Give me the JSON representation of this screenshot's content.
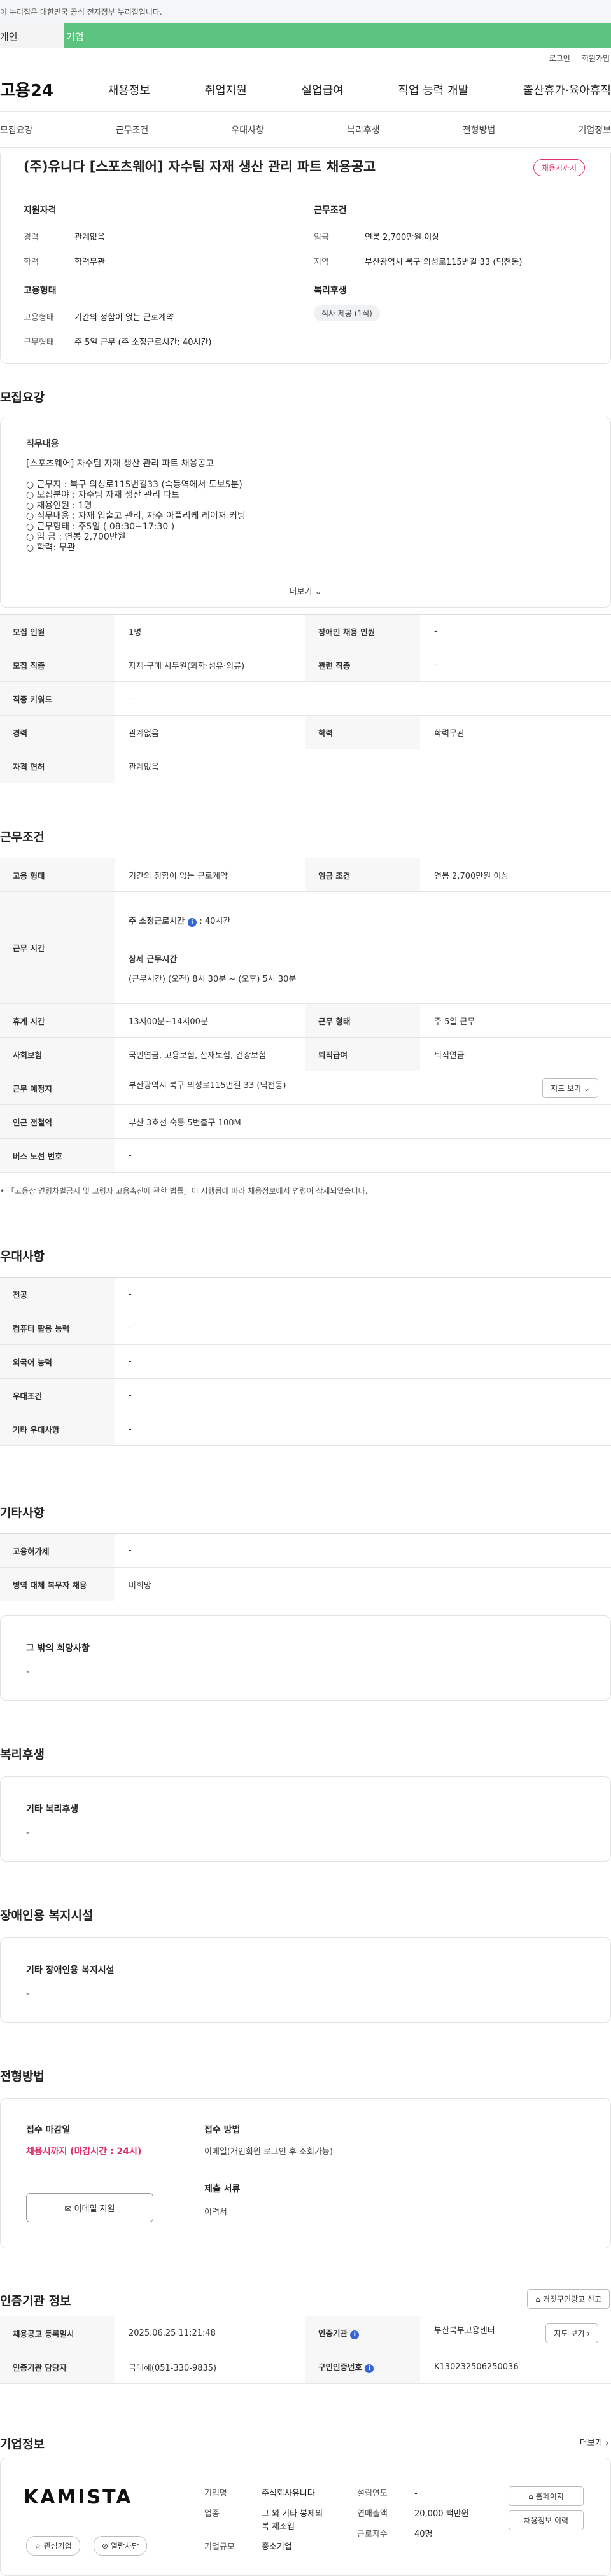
{
  "topbar": {
    "text": "이 누리집은 대한민국 공식 전자정부 누리집입니다."
  },
  "tabs": {
    "a": "개인",
    "b": "기업"
  },
  "util": {
    "login": "로그인",
    "join": "회원가입"
  },
  "gnb": {
    "logo": "고용24",
    "items": [
      "채용정보",
      "취업지원",
      "실업급여",
      "직업 능력 개발",
      "출산휴가·육아휴직"
    ]
  },
  "subnav": [
    "모집요강",
    "근무조건",
    "우대사항",
    "복리후생",
    "전형방법",
    "기업정보"
  ],
  "summary": {
    "title": "(주)유니다 [스포츠웨어] 자수팀 자재 생산 관리 파트 채용공고",
    "badge": "채용시까지",
    "qual": {
      "title": "지원자격",
      "k1": "경력",
      "v1": "관계없음",
      "k2": "학력",
      "v2": "학력무관"
    },
    "cond": {
      "title": "근무조건",
      "k1": "임금",
      "v1": "연봉 2,700만원 이상",
      "k2": "지역",
      "v2": "부산광역시 북구 의성로115번길 33 (덕천동)"
    },
    "emp": {
      "title": "고용형태",
      "k1": "고용형태",
      "v1": "기간의 정함이 없는 근로계약",
      "k2": "근무형태",
      "v2": "주 5일 근무 (주 소정근로시간: 40시간)"
    },
    "welfare": {
      "title": "복리후생",
      "chip": "식사 제공 (1식)"
    }
  },
  "recruit": {
    "title": "모집요강",
    "duty_title": "직무내용",
    "duty_lines": [
      "[스포츠웨어] 자수팀 자재 생산 관리 파트 채용공고",
      "",
      "○ 근무지 : 북구 의성로115번길33 (숙등역에서 도보5분)",
      "○ 모집분야 : 자수팀 자재 생산 관리 파트",
      "○ 채용인원 : 1명",
      "○ 직무내용 : 자재 입출고 관리, 자수 아플리케 레이저 커팅",
      "○ 근무형태 : 주5일 ( 08:30~17:30 )",
      "○ 임 금 : 연봉 2,700만원",
      "○ 학력: 무관"
    ],
    "more": "더보기",
    "table": {
      "r1": [
        "모집 인원",
        "1명",
        "장애인 채용 인원",
        "-"
      ],
      "r2": [
        "모집 직종",
        "자재·구매 사무원(화학·섬유·의류)",
        "관련 직종",
        "-"
      ],
      "r3": [
        "직종 키워드",
        "-"
      ],
      "r4": [
        "경력",
        "관계없음",
        "학력",
        "학력무관"
      ],
      "r5": [
        "자격 면허",
        "관계없음"
      ]
    }
  },
  "work": {
    "title": "근무조건",
    "r1": [
      "고용 형태",
      "기간의 정함이 없는 근로계약",
      "임금 조건",
      "연봉 2,700만원 이상"
    ],
    "r2": {
      "th": "근무 시간",
      "line1": "주 소정근로시간",
      "line1b": ": 40시간",
      "line2": "상세 근무시간",
      "line3": "(근무시간) (오전) 8시 30분 ~ (오후) 5시 30분"
    },
    "r3": [
      "휴게 시간",
      "13시00분~14시00분",
      "근무 형태",
      "주 5일 근무"
    ],
    "r4": [
      "사회보험",
      "국민연금, 고용보험, 산재보험, 건강보험",
      "퇴직급여",
      "퇴직연금"
    ],
    "r5": [
      "근무 예정지",
      "부산광역시 북구 의성로115번길 33 (덕천동)"
    ],
    "map_btn": "지도 보기",
    "r6": [
      "인근 전철역",
      "부산 3호선 숙등 5번출구 100M"
    ],
    "r7": [
      "버스 노선 번호",
      "-"
    ],
    "note": "「고용상 연령차별금지 및 고령자 고용촉진에 관한 법률」이 시행됨에 따라 채용정보에서 연령이 삭제되었습니다."
  },
  "pref": {
    "title": "우대사항",
    "rows": [
      [
        "전공",
        "-"
      ],
      [
        "컴퓨터 활용 능력",
        "-"
      ],
      [
        "외국어 능력",
        "-"
      ],
      [
        "우대조건",
        "-"
      ],
      [
        "기타 우대사항",
        "-"
      ]
    ]
  },
  "etc": {
    "title": "기타사항",
    "rows": [
      [
        "고용허가제",
        "-"
      ],
      [
        "병역 대체 복무자 채용",
        "비희망"
      ]
    ],
    "box_title": "그 밖의 희망사항",
    "box_val": "-"
  },
  "welfare2": {
    "title": "복리후생",
    "box_title": "기타 복리후생",
    "box_val": "-"
  },
  "disabled": {
    "title": "장애인용 복지시설",
    "box_title": "기타 장애인용 복지시설",
    "box_val": "-"
  },
  "process": {
    "title": "전형방법",
    "deadline_title": "접수 마감일",
    "deadline_val": "채용시까지 (마감시간 : 24시)",
    "apply_btn": "이메일 지원",
    "method_title": "접수 방법",
    "method_val": "이메일(개인회원 로그인 후 조회가능)",
    "docs_title": "제출 서류",
    "docs_val": "이력서"
  },
  "agency": {
    "title": "인증기관 정보",
    "report_btn": "거짓구인광고 신고",
    "r1": [
      "채용공고 등록일시",
      "2025.06.25 11:21:48",
      "인증기관",
      "부산북부고용센터"
    ],
    "r1_btn": "지도 보기",
    "r2": [
      "인증기관 담당자",
      "금대혜(051-330-9835)",
      "구인인증번호",
      "K130232506250036"
    ]
  },
  "company": {
    "title": "기업정보",
    "more": "더보기",
    "logo_text": "KAMISTA",
    "fav_btn": "관심기업",
    "block_btn": "열람차단",
    "k1": "기업명",
    "v1": "주식회사유니다",
    "k2": "업종",
    "v2a": "그 외 기타 봉제의",
    "v2b": "복 제조업",
    "k3": "기업규모",
    "v3": "중소기업",
    "k4": "설립연도",
    "v4": "-",
    "k5": "연매출액",
    "v5": "20,000 백만원",
    "k6": "근로자수",
    "v6": "40명",
    "home_btn": "홈페이지",
    "list_btn": "채용정보 이력"
  }
}
